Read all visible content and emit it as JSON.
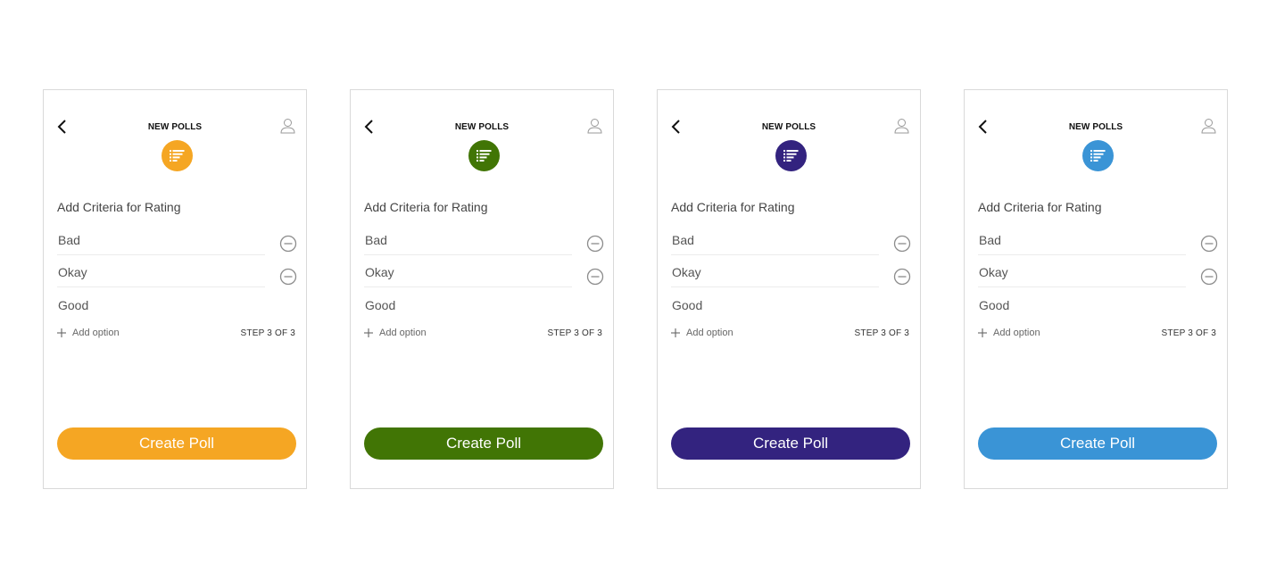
{
  "screens": [
    {
      "accent": "#F5A623",
      "title": "NEW POLLS",
      "heading": "Add Criteria for Rating",
      "options": [
        "Bad",
        "Okay",
        "Good"
      ],
      "add_option_label": "Add option",
      "step": "STEP 3 OF 3",
      "button_label": "Create Poll"
    },
    {
      "accent": "#417505",
      "title": "NEW POLLS",
      "heading": "Add Criteria for Rating",
      "options": [
        "Bad",
        "Okay",
        "Good"
      ],
      "add_option_label": "Add option",
      "step": "STEP 3 OF 3",
      "button_label": "Create Poll"
    },
    {
      "accent": "#33237F",
      "title": "NEW POLLS",
      "heading": "Add Criteria for Rating",
      "options": [
        "Bad",
        "Okay",
        "Good"
      ],
      "add_option_label": "Add option",
      "step": "STEP 3 OF 3",
      "button_label": "Create Poll"
    },
    {
      "accent": "#3A94D6",
      "title": "NEW POLLS",
      "heading": "Add Criteria for Rating",
      "options": [
        "Bad",
        "Okay",
        "Good"
      ],
      "add_option_label": "Add option",
      "step": "STEP 3 OF 3",
      "button_label": "Create Poll"
    }
  ],
  "icons": {
    "back": "chevron-left-icon",
    "profile": "user-icon",
    "poll": "poll-list-icon",
    "remove": "minus-circle-icon",
    "add": "plus-icon"
  }
}
